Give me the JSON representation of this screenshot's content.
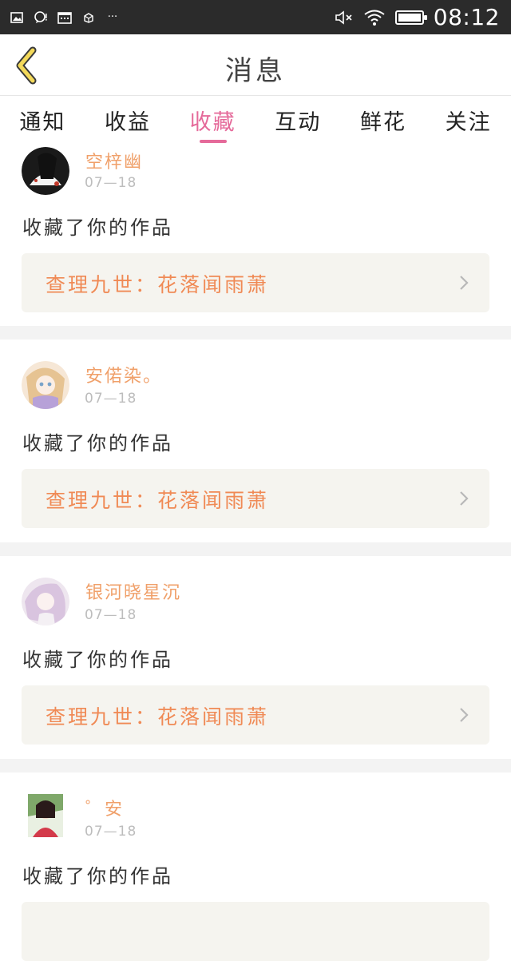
{
  "status_bar": {
    "time": "08:12",
    "icons_left": [
      "image-icon",
      "chat-alert-icon",
      "calendar-icon",
      "package-icon",
      "more-dots-icon"
    ],
    "icons_right": [
      "mute-icon",
      "wifi-icon",
      "battery-icon"
    ],
    "more_text": "···"
  },
  "header": {
    "title": "消息"
  },
  "tabs": [
    {
      "label": "通知",
      "active": false
    },
    {
      "label": "收益",
      "active": false
    },
    {
      "label": "收藏",
      "active": true
    },
    {
      "label": "互动",
      "active": false
    },
    {
      "label": "鲜花",
      "active": false
    },
    {
      "label": "关注",
      "active": false
    }
  ],
  "notifications": [
    {
      "username": "空梓幽",
      "date": "07—18",
      "action": "收藏了你的作品",
      "work": "查理九世：花落闻雨萧"
    },
    {
      "username": "安偌染。",
      "date": "07—18",
      "action": "收藏了你的作品",
      "work": "查理九世：花落闻雨萧"
    },
    {
      "username": "银河晓星沉",
      "date": "07—18",
      "action": "收藏了你的作品",
      "work": "查理九世：花落闻雨萧"
    },
    {
      "username": "゜安",
      "date": "07—18",
      "action": "收藏了你的作品",
      "work": ""
    }
  ],
  "colors": {
    "accent": "#e56a9a",
    "username": "#f0a06a",
    "work_title": "#f08a55",
    "statusbar": "#2b2b2b"
  }
}
